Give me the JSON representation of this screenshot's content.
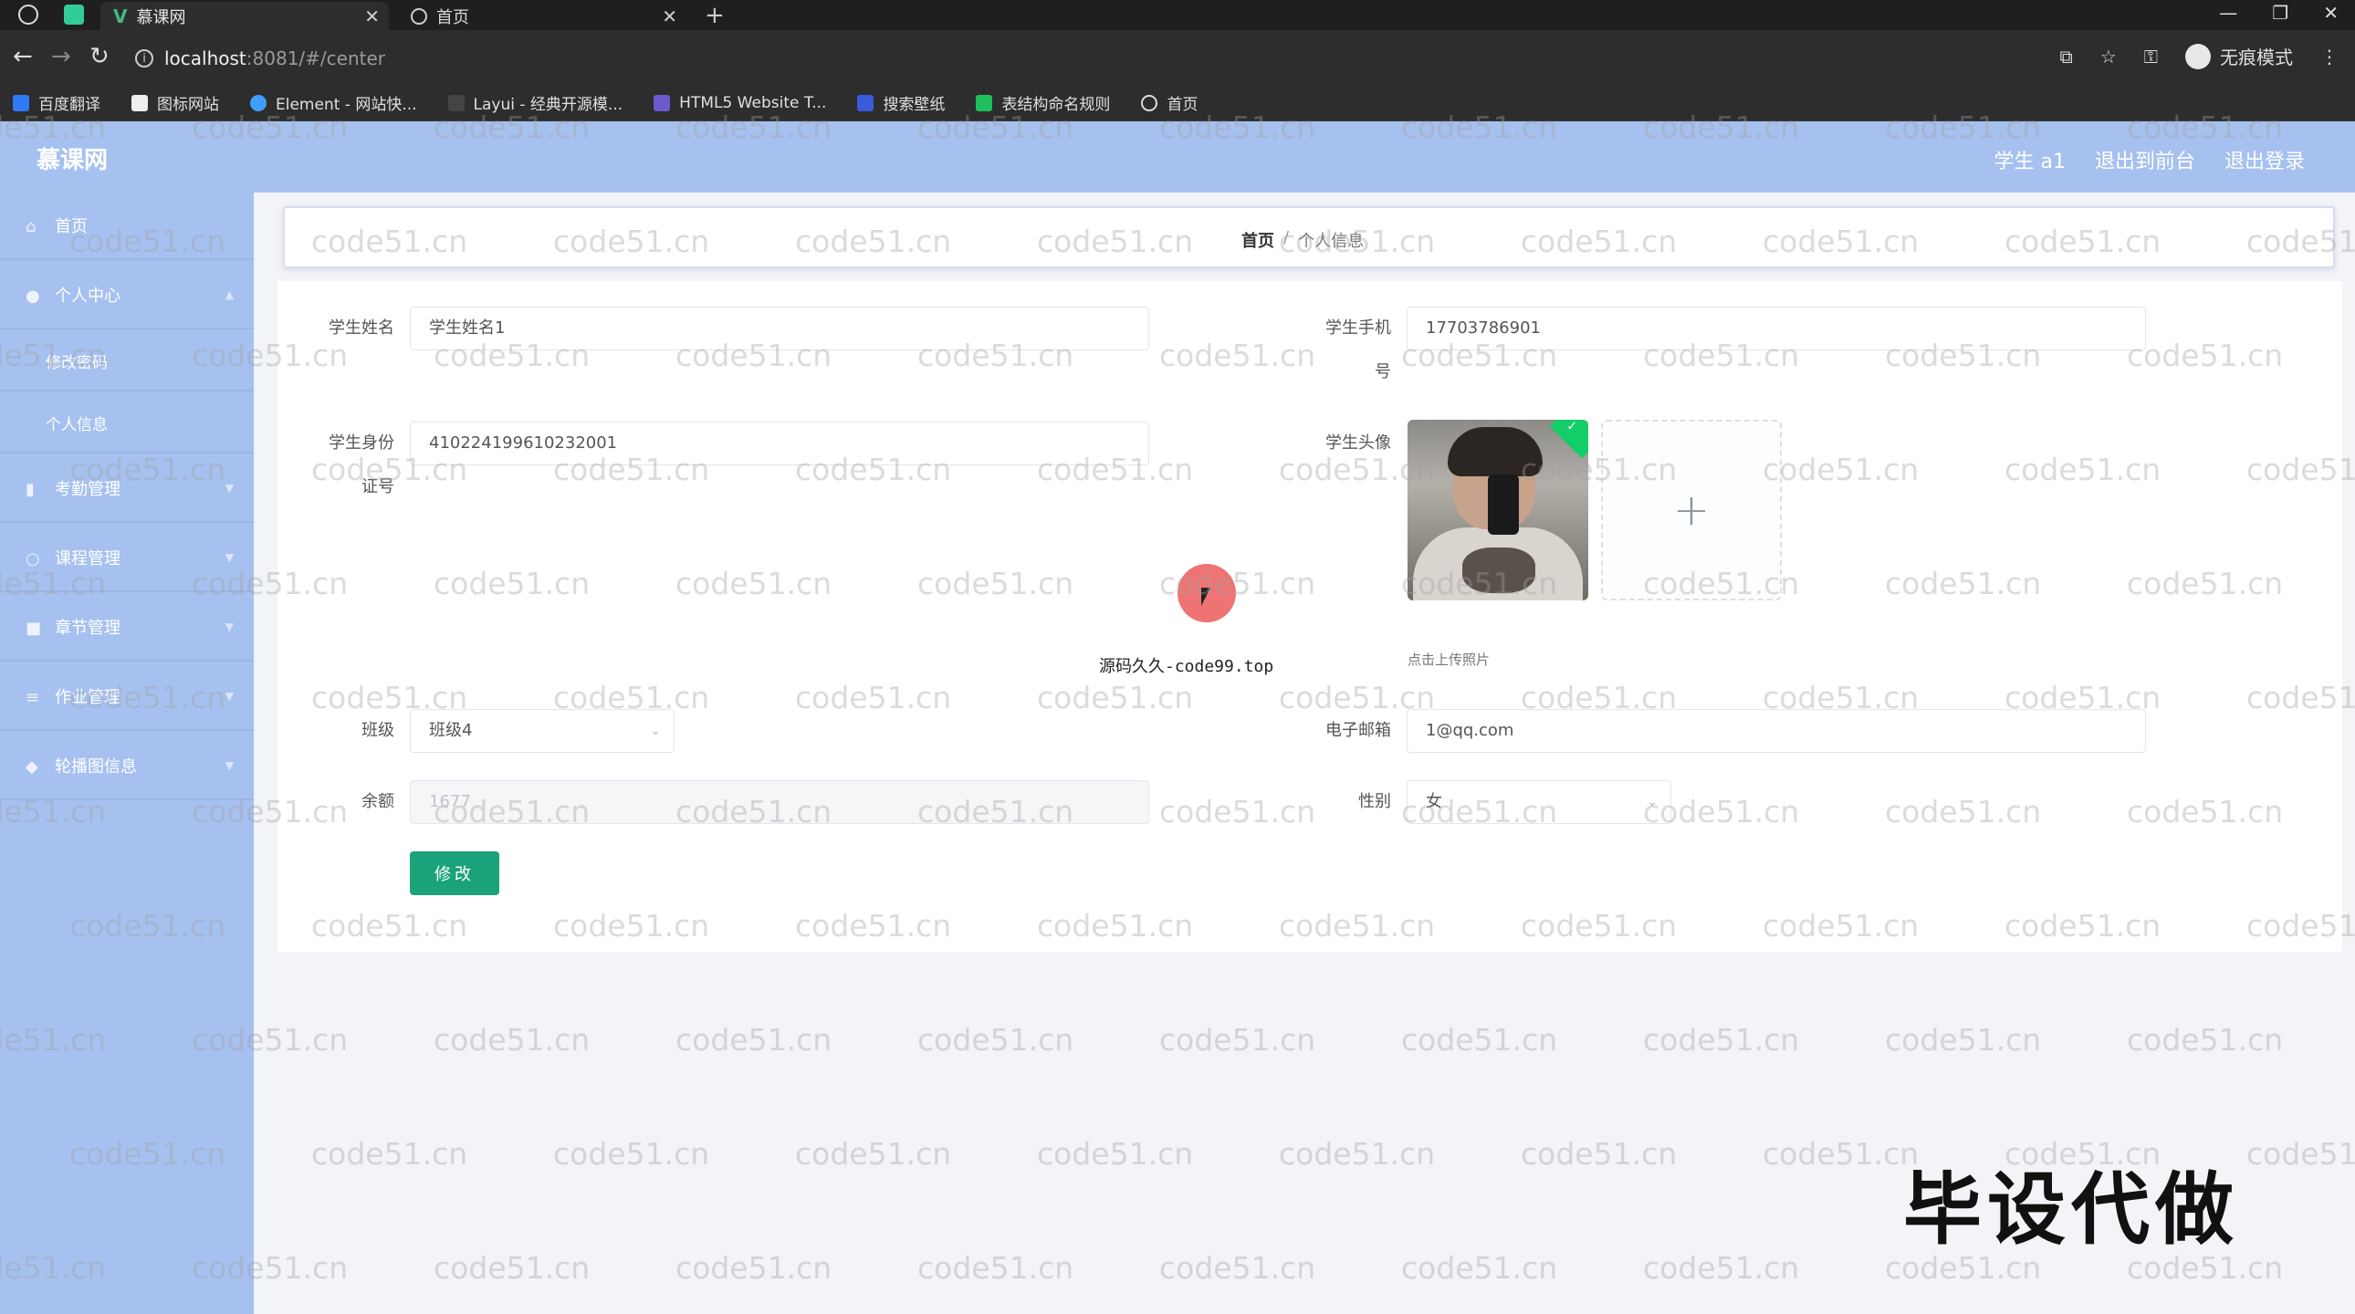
{
  "browser": {
    "tabs": [
      {
        "title": "慕课网",
        "active": true
      },
      {
        "title": "首页",
        "active": false
      }
    ],
    "url_host": "localhost",
    "url_path": ":8081/#/center",
    "profile_label": "无痕模式",
    "bookmarks": [
      "百度翻译",
      "图标网站",
      "Element - 网站快...",
      "Layui - 经典开源模...",
      "HTML5 Website T...",
      "搜索壁纸",
      "表结构命名规则",
      "首页"
    ]
  },
  "app": {
    "title": "慕课网",
    "header_links": [
      "学生 a1",
      "退出到前台",
      "退出登录"
    ]
  },
  "sidebar": {
    "items": [
      {
        "label": "首页",
        "icon": "home-icon"
      },
      {
        "label": "个人中心",
        "icon": "user-icon"
      },
      {
        "label": "修改密码",
        "sub": true
      },
      {
        "label": "个人信息",
        "sub": true
      },
      {
        "label": "考勤管理",
        "icon": "chart-icon"
      },
      {
        "label": "课程管理",
        "icon": "circle-icon"
      },
      {
        "label": "章节管理",
        "icon": "box-icon"
      },
      {
        "label": "作业管理",
        "icon": "list-icon"
      },
      {
        "label": "轮播图信息",
        "icon": "pin-icon"
      }
    ]
  },
  "breadcrumb": {
    "home": "首页",
    "separator": "/",
    "current": "个人信息"
  },
  "form": {
    "student_name_label": "学生姓名",
    "student_name_value": "学生姓名1",
    "phone_label_line1": "学生手机",
    "phone_label_line2": "号",
    "phone_value": "17703786901",
    "id_label_line1": "学生身份",
    "id_label_line2": "证号",
    "id_value": "410224199610232001",
    "avatar_label": "学生头像",
    "upload_tip": "点击上传照片",
    "class_label": "班级",
    "class_value": "班级4",
    "email_label": "电子邮箱",
    "email_value": "1@qq.com",
    "balance_label": "余额",
    "balance_value": "1677",
    "gender_label": "性别",
    "gender_value": "女",
    "submit_label": "修改"
  },
  "overlay": {
    "promo_text": "源码久久-code99.top",
    "big_promo": "毕设代做",
    "watermark": "code51.cn"
  },
  "colors": {
    "accent": "#a6c1f0",
    "button": "#1aa37a",
    "success": "#13ce66"
  }
}
